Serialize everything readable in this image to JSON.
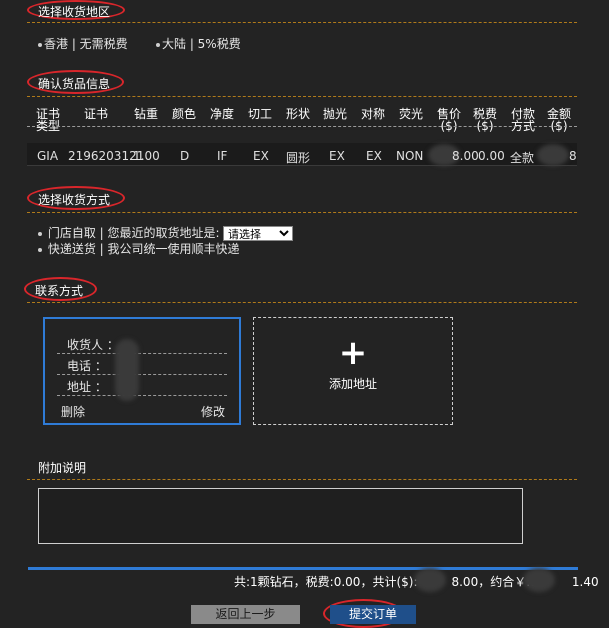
{
  "sections": {
    "region": "选择收货地区",
    "goods": "确认货品信息",
    "delivery": "选择收货方式",
    "contact": "联系方式",
    "notes": "附加说明"
  },
  "region_options": [
    {
      "label": "香港 | 无需税费"
    },
    {
      "label": "大陆 | 5%税费"
    }
  ],
  "table": {
    "headers": [
      "证书类型",
      "证书",
      "钻重",
      "颜色",
      "净度",
      "切工",
      "形状",
      "抛光",
      "对称",
      "荧光",
      "售价($)",
      "税费($)",
      "付款方式",
      "金额($)"
    ],
    "row": [
      "GIA",
      "2196203121",
      "1.00",
      "D",
      "IF",
      "EX",
      "圆形",
      "EX",
      "EX",
      "NON",
      "8.00",
      "0.00",
      "全款",
      "8"
    ]
  },
  "delivery_options": {
    "pickup": "门店自取 | 您最近的取货地址是:",
    "pickup_select_value": "请选择",
    "express": "快递送货 | 我公司统一使用顺丰快递"
  },
  "address_card": {
    "receiver_label": "收货人 ：",
    "phone_label": "电话 ：",
    "address_label": "地址 ：",
    "delete": "删除",
    "edit": "修改"
  },
  "add_address": {
    "plus": "+",
    "label": "添加地址"
  },
  "summary": {
    "part1": "共:1颗钻石，税费:0.00，共计($):",
    "total_tail": "8.00，约合￥:1",
    "rmb_tail": "1.40"
  },
  "buttons": {
    "back": "返回上一步",
    "submit": "提交订单"
  },
  "colors": {
    "accent_red": "#d9262b",
    "accent_blue": "#2f7bd6",
    "divider_orange": "#b07a1a",
    "submit_bg": "#1f4f8a",
    "back_bg": "#8a8a8a"
  }
}
